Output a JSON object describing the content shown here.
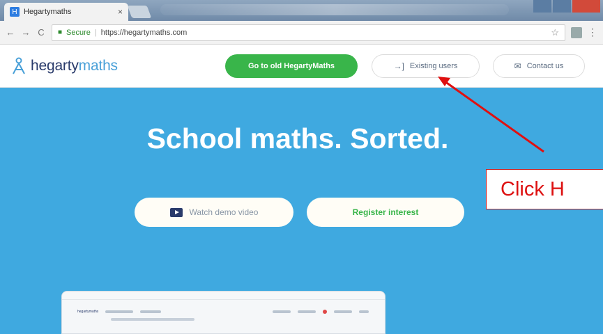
{
  "browser": {
    "tab_title": "Hegartymaths",
    "tab_close": "×",
    "secure_label": "Secure",
    "url": "https://hegartymaths.com",
    "star": "☆",
    "menu": "⋮"
  },
  "header": {
    "logo_text_1": "hegarty",
    "logo_text_2": "maths",
    "go_old_button": "Go to old HegartyMaths",
    "existing_users_button": "Existing users",
    "contact_button": "Contact us"
  },
  "hero": {
    "title": "School maths. Sorted.",
    "watch_demo": "Watch demo video",
    "register_interest": "Register interest",
    "preview_logo": "hegartymaths"
  },
  "annotation": {
    "callout_text": "Click H",
    "color": "#dd1111"
  },
  "colors": {
    "hero_background": "#3fa9e0",
    "primary_green": "#39b54a",
    "navy": "#2a3b6b"
  },
  "icons": [
    "back-icon",
    "forward-icon",
    "reload-icon",
    "lock-icon",
    "star-icon",
    "sign-in-icon",
    "mail-icon",
    "play-icon"
  ]
}
